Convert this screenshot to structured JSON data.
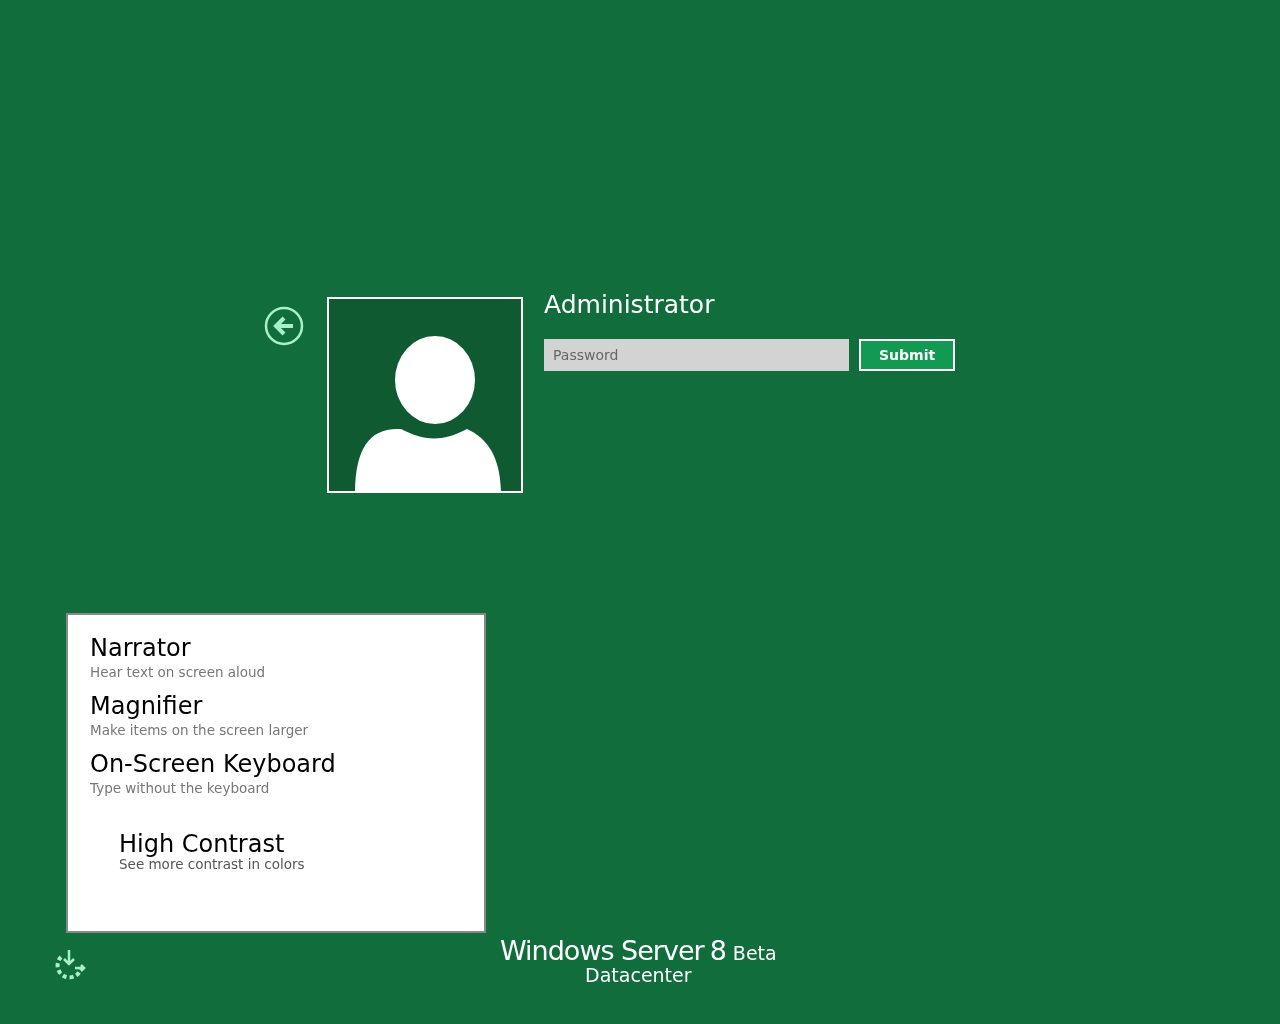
{
  "user": {
    "name": "Administrator"
  },
  "password": {
    "placeholder": "Password"
  },
  "submit": {
    "label": "Submit"
  },
  "ease_of_access_menu": [
    {
      "kind": "action",
      "title": "Narrator",
      "description": "Hear text on screen aloud"
    },
    {
      "kind": "action",
      "title": "Magnifier",
      "description": "Make items on the screen larger"
    },
    {
      "kind": "action",
      "title": "On-Screen Keyboard",
      "description": "Type without the keyboard"
    },
    {
      "kind": "toggle",
      "title": "High Contrast",
      "description": "See more contrast in colors"
    }
  ],
  "branding": {
    "product": "Windows Server",
    "version": "8",
    "stage": "Beta",
    "edition": "Datacenter"
  }
}
